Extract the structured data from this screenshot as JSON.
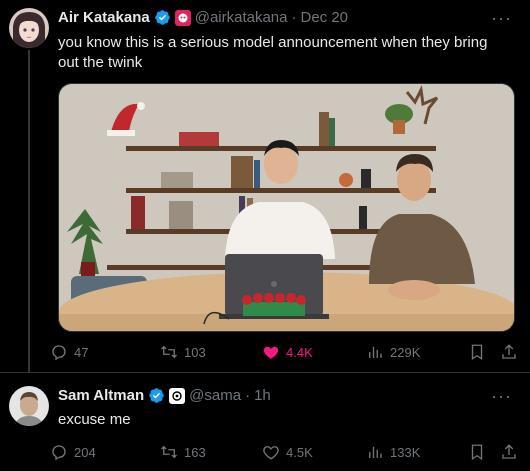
{
  "tweet1": {
    "display_name": "Air Katakana",
    "handle": "@airkatakana",
    "separator": "·",
    "date": "Dec 20",
    "text": "you know this is a serious model announcement when they bring out the twink",
    "more_label": "···",
    "media_icon": "video-still",
    "actions": {
      "replies": "47",
      "reposts": "103",
      "likes": "4.4K",
      "views": "229K"
    },
    "liked": true,
    "like_color": "#f91880"
  },
  "tweet2": {
    "display_name": "Sam Altman",
    "handle": "@sama",
    "separator": "·",
    "date": "1h",
    "text": "excuse me",
    "more_label": "···",
    "actions": {
      "replies": "204",
      "reposts": "163",
      "likes": "4.5K",
      "views": "133K"
    }
  },
  "colors": {
    "background": "#000000",
    "verified": "#1d9bf0",
    "muted": "#71767b"
  }
}
